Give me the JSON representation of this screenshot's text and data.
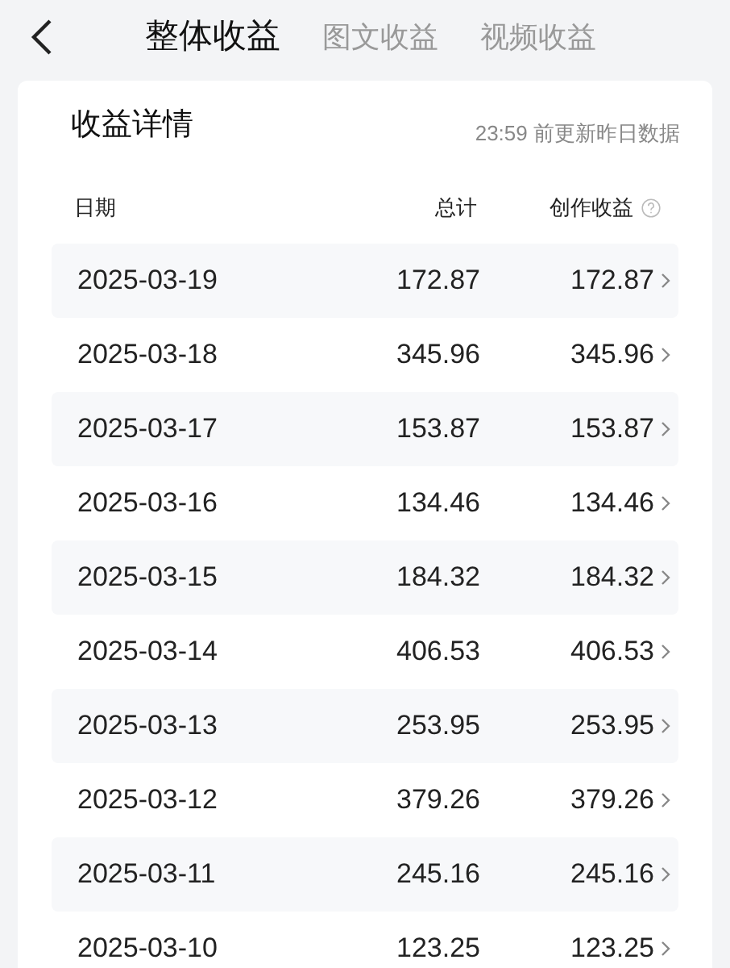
{
  "tabs": [
    {
      "label": "整体收益",
      "selected": true
    },
    {
      "label": "图文收益",
      "selected": false
    },
    {
      "label": "视频收益",
      "selected": false
    }
  ],
  "card": {
    "title": "收益详情",
    "update_note": "23:59 前更新昨日数据",
    "columns": [
      "日期",
      "总计",
      "创作收益"
    ],
    "rows": [
      {
        "date": "2025-03-19",
        "total": "172.87",
        "creation": "172.87"
      },
      {
        "date": "2025-03-18",
        "total": "345.96",
        "creation": "345.96"
      },
      {
        "date": "2025-03-17",
        "total": "153.87",
        "creation": "153.87"
      },
      {
        "date": "2025-03-16",
        "total": "134.46",
        "creation": "134.46"
      },
      {
        "date": "2025-03-15",
        "total": "184.32",
        "creation": "184.32"
      },
      {
        "date": "2025-03-14",
        "total": "406.53",
        "creation": "406.53"
      },
      {
        "date": "2025-03-13",
        "total": "253.95",
        "creation": "253.95"
      },
      {
        "date": "2025-03-12",
        "total": "379.26",
        "creation": "379.26"
      },
      {
        "date": "2025-03-11",
        "total": "245.16",
        "creation": "245.16"
      },
      {
        "date": "2025-03-10",
        "total": "123.25",
        "creation": "123.25"
      }
    ]
  }
}
